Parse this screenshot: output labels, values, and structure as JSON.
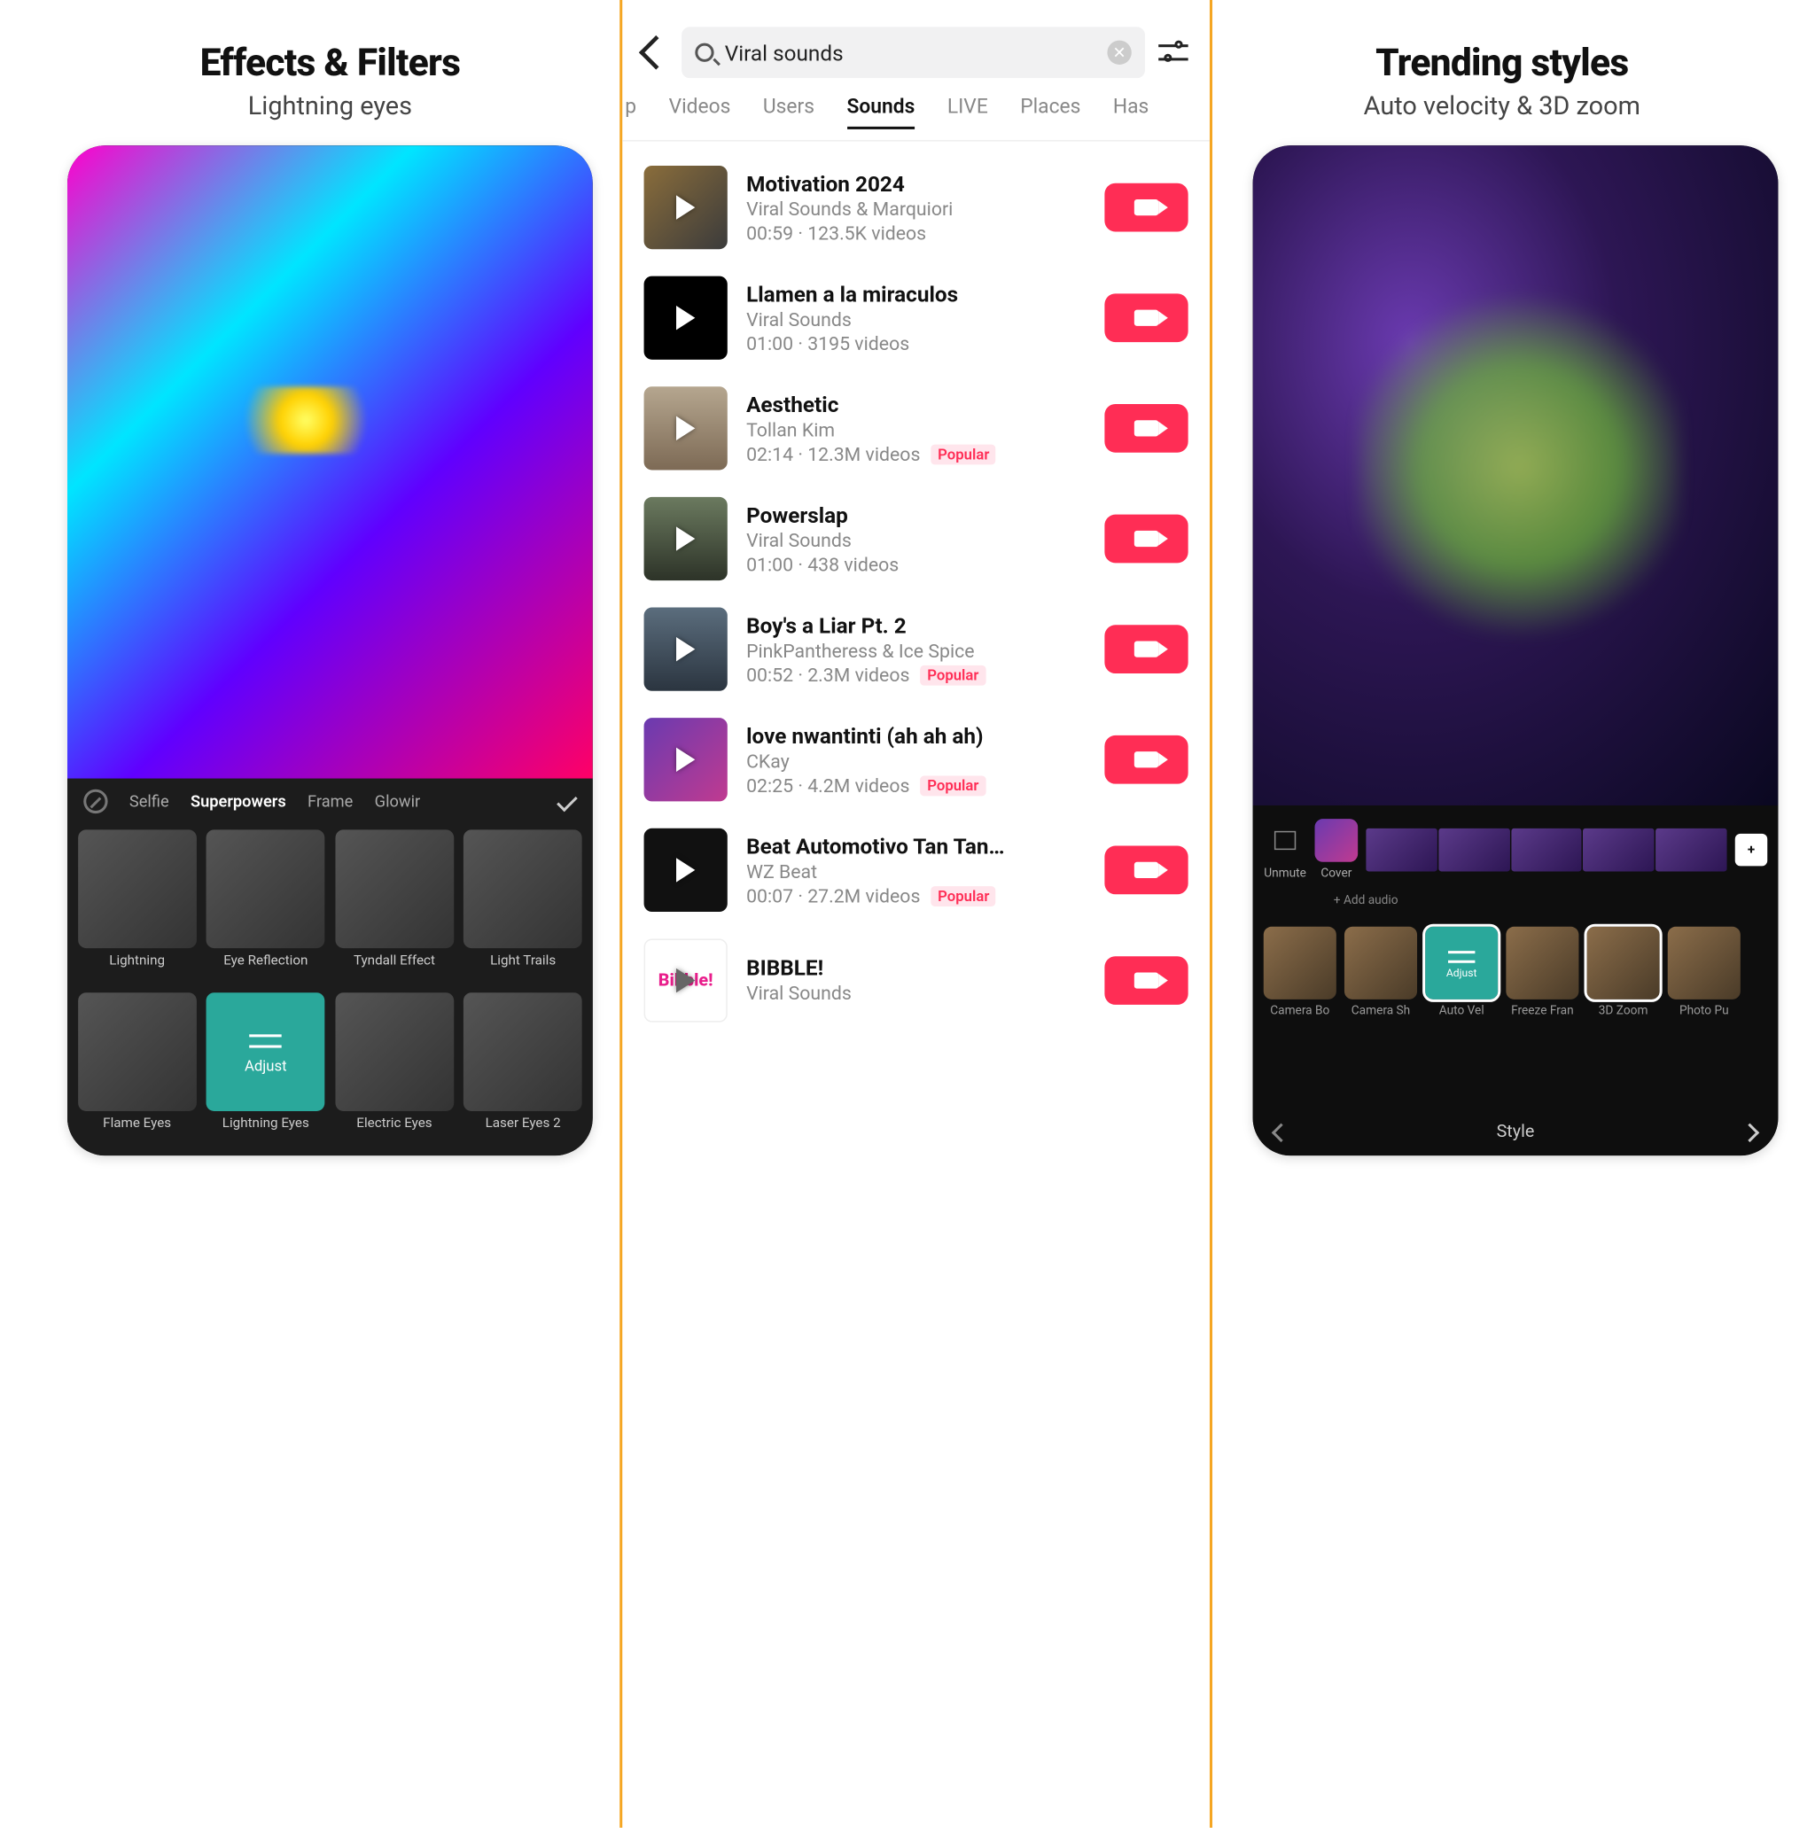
{
  "panel1": {
    "title": "Effects & Filters",
    "subtitle": "Lightning eyes",
    "tabs": [
      "Selfie",
      "Superpowers",
      "Frame",
      "Glowir"
    ],
    "active_tab": "Superpowers",
    "effects_row1": [
      "Lightning",
      "Eye Reflection",
      "Tyndall Effect",
      "Light Trails"
    ],
    "effects_row2": [
      "Flame Eyes",
      "Lightning Eyes",
      "Electric Eyes",
      "Laser Eyes 2"
    ],
    "adjust_label": "Adjust"
  },
  "panel2": {
    "search_value": "Viral sounds",
    "tabs": [
      "p",
      "Videos",
      "Users",
      "Sounds",
      "LIVE",
      "Places",
      "Has"
    ],
    "active_tab": "Sounds",
    "sounds": [
      {
        "title": "Motivation 2024",
        "artist": "Viral Sounds & Marquiori",
        "duration": "00:59",
        "videos": "123.5K videos",
        "popular": false,
        "thumb": "mot"
      },
      {
        "title": "Llamen a la miraculos",
        "artist": "Viral Sounds",
        "duration": "01:00",
        "videos": "3195 videos",
        "popular": false,
        "thumb": "black"
      },
      {
        "title": "Aesthetic",
        "artist": "Tollan Kim",
        "duration": "02:14",
        "videos": "12.3M videos",
        "popular": true,
        "thumb": "aes"
      },
      {
        "title": "Powerslap",
        "artist": "Viral Sounds",
        "duration": "01:00",
        "videos": "438 videos",
        "popular": false,
        "thumb": "pwr"
      },
      {
        "title": "Boy's a Liar Pt. 2",
        "artist": "PinkPantheress & Ice Spice",
        "duration": "00:52",
        "videos": "2.3M videos",
        "popular": true,
        "thumb": "liar"
      },
      {
        "title": "love nwantinti (ah ah ah)",
        "artist": "CKay",
        "duration": "02:25",
        "videos": "4.2M videos",
        "popular": true,
        "thumb": "nwa"
      },
      {
        "title": "Beat Automotivo Tan Tan…",
        "artist": "WZ Beat",
        "duration": "00:07",
        "videos": "27.2M videos",
        "popular": true,
        "thumb": "beat"
      },
      {
        "title": "BIBBLE!",
        "artist": "Viral Sounds",
        "duration": "",
        "videos": "",
        "popular": false,
        "thumb": "bib"
      }
    ],
    "popular_label": "Popular",
    "bibble_text": "Bibble!"
  },
  "panel3": {
    "title": "Trending styles",
    "subtitle": "Auto velocity & 3D zoom",
    "unmute_label": "Unmute",
    "cover_label": "Cover",
    "add_audio_label": "+ Add audio",
    "styles": [
      "Camera Bo",
      "Camera Sh",
      "Auto Vel",
      "Freeze Fran",
      "3D Zoom",
      "Photo Pu"
    ],
    "adjust_label": "Adjust",
    "selected_styles": [
      "Auto Vel",
      "3D Zoom"
    ],
    "footer_label": "Style"
  }
}
